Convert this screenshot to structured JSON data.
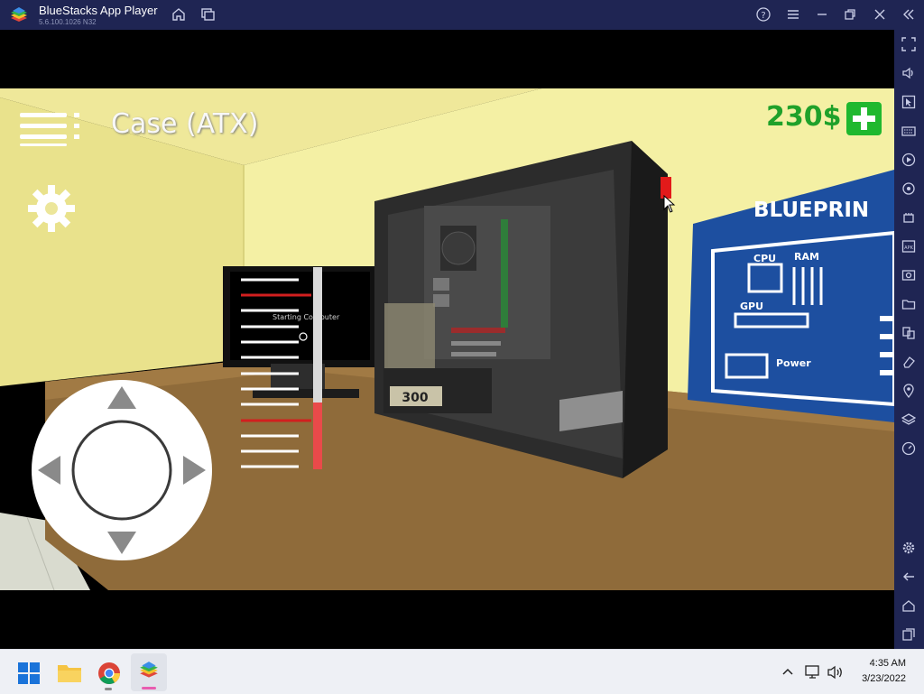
{
  "window": {
    "title": "BlueStacks App Player",
    "version": "5.6.100.1026 N32"
  },
  "game": {
    "item_name": "Case (ATX)",
    "money": "230$",
    "monitor_text": "Starting Computer",
    "psu_label": "300",
    "blueprint": {
      "title": "BLUEPRIN",
      "cpu": "CPU",
      "ram": "RAM",
      "gpu": "GPU",
      "power": "Power"
    },
    "meter_fill_fraction": 0.33
  },
  "taskbar": {
    "time": "4:35 AM",
    "date": "3/23/2022"
  },
  "colors": {
    "titlebar": "#1f2553",
    "money_green": "#1fa12a",
    "add_button": "#1fb82e",
    "wall": "#f3ef9e",
    "desk": "#8f6b3a",
    "blueprint_bg": "#1d4fa0",
    "meter_red": "#e94a4a"
  }
}
